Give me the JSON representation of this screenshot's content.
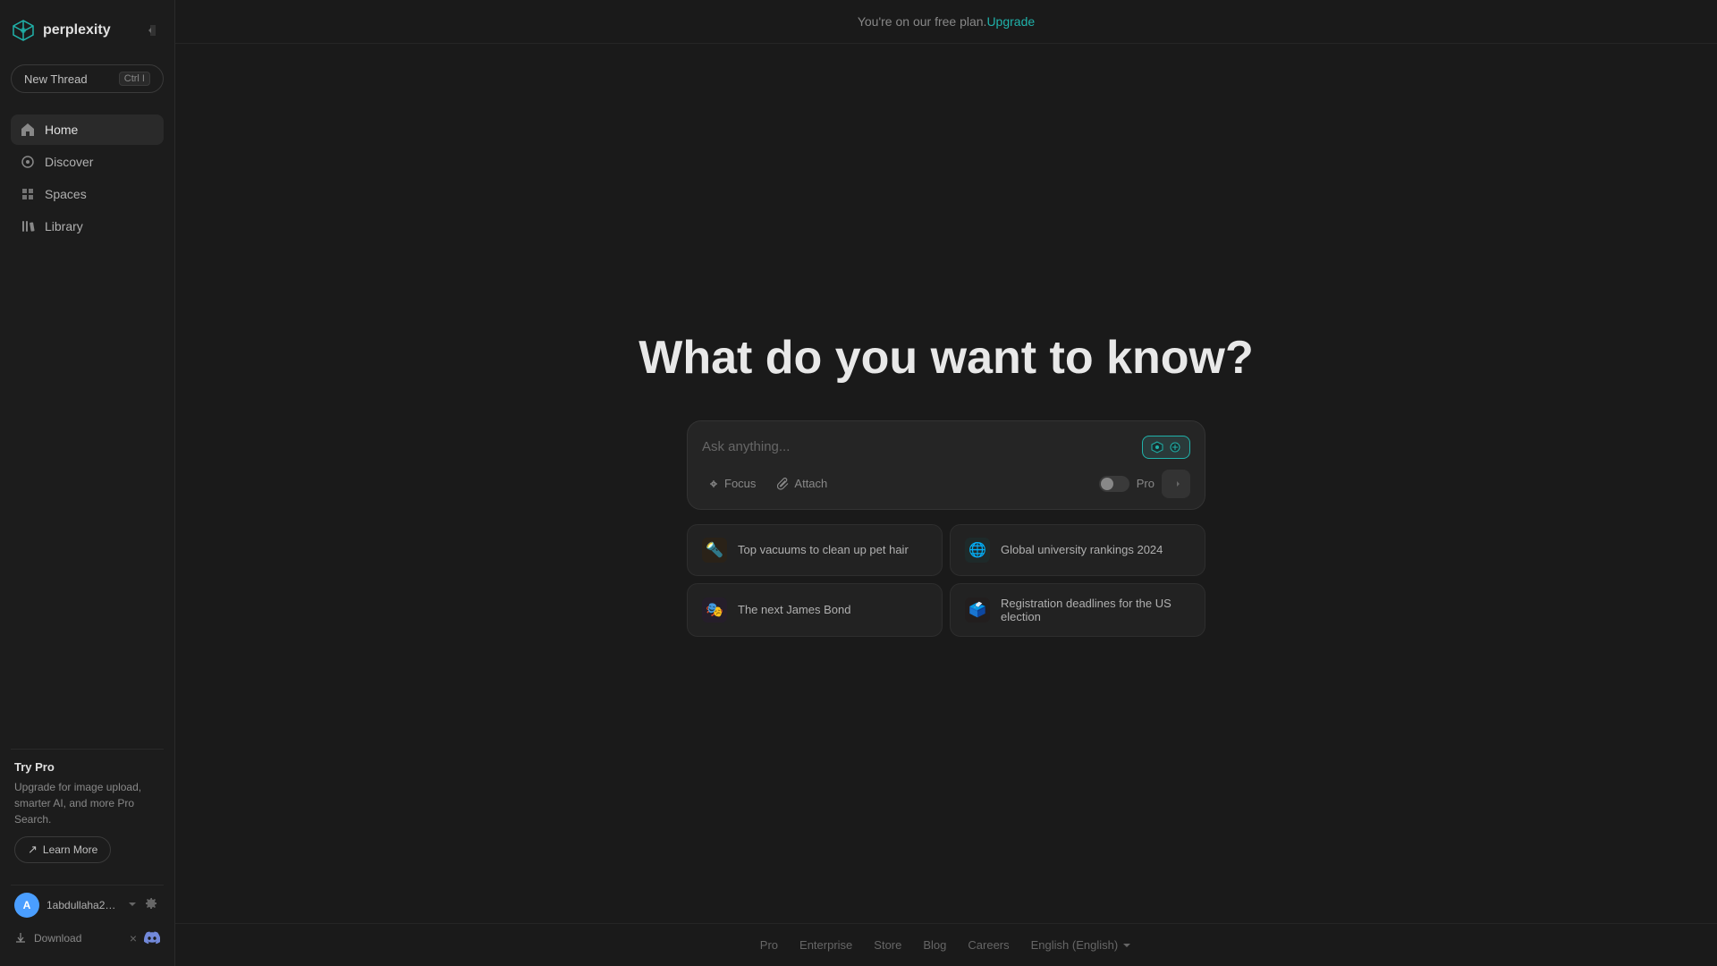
{
  "app": {
    "name": "perplexity",
    "tagline": "What do you want to know?"
  },
  "topbar": {
    "free_plan_text": "You're on our free plan.",
    "upgrade_label": "Upgrade"
  },
  "sidebar": {
    "collapse_icon": "◀",
    "new_thread_label": "New Thread",
    "new_thread_shortcut": "Ctrl I",
    "nav_items": [
      {
        "id": "home",
        "label": "Home",
        "icon": "⌂",
        "active": true
      },
      {
        "id": "discover",
        "label": "Discover",
        "icon": "◉"
      },
      {
        "id": "spaces",
        "label": "Spaces",
        "icon": "✦"
      },
      {
        "id": "library",
        "label": "Library",
        "icon": "☰"
      }
    ]
  },
  "try_pro": {
    "title": "Try Pro",
    "description": "Upgrade for image upload, smarter AI, and more Pro Search.",
    "learn_more_label": "Learn More"
  },
  "user": {
    "avatar_initial": "A",
    "username": "1abdullaha20...",
    "chevron": "∨",
    "gear": "⚙"
  },
  "download": {
    "label": "Download",
    "close_label": "×",
    "discord_label": "Discord"
  },
  "search": {
    "placeholder": "Ask anything...",
    "focus_label": "Focus",
    "attach_label": "Attach",
    "pro_label": "Pro",
    "submit_arrow": "→"
  },
  "suggestions": [
    {
      "id": "vacuums",
      "icon": "🔦",
      "icon_bg": "#2a2218",
      "label": "Top vacuums to clean up pet hair"
    },
    {
      "id": "university",
      "icon": "🌐",
      "icon_bg": "#1e2a2a",
      "label": "Global university rankings 2024"
    },
    {
      "id": "bond",
      "icon": "🎭",
      "icon_bg": "#251e2a",
      "label": "The next James Bond"
    },
    {
      "id": "election",
      "icon": "🗳",
      "icon_bg": "#221e1e",
      "label": "Registration deadlines for the US election"
    }
  ],
  "footer": {
    "links": [
      {
        "id": "pro",
        "label": "Pro"
      },
      {
        "id": "enterprise",
        "label": "Enterprise"
      },
      {
        "id": "store",
        "label": "Store"
      },
      {
        "id": "blog",
        "label": "Blog"
      },
      {
        "id": "careers",
        "label": "Careers"
      }
    ],
    "language": "English (English)"
  }
}
